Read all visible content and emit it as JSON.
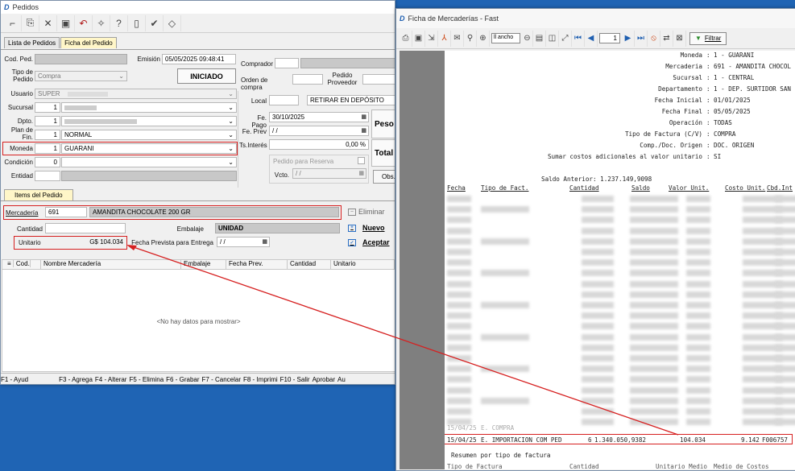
{
  "pedidos": {
    "title": "Pedidos",
    "tabs": [
      "Lista de Pedidos",
      "Ficha del Pedido"
    ],
    "labels": {
      "cod_ped": "Cod. Ped.",
      "emision": "Emisión",
      "tipo_pedido": "Tipo de Pedido",
      "usuario": "Usuario",
      "sucursal": "Sucursal",
      "dpto": "Dpto.",
      "plan_fin": "Plan de Fin.",
      "moneda": "Moneda",
      "condicion": "Condición",
      "entidad": "Entidad",
      "comprador": "Comprador",
      "orden_compra": "Orden de compra",
      "pedido_proveedor": "Pedido Proveedor",
      "local": "Local",
      "fe_pago": "Fe. Pago",
      "fe_prev": "Fe. Prev",
      "tasa_interes": "Ts.Interés",
      "pedido_reserva": "Pedido para Reserva",
      "vcto": "Vcto.",
      "peso": "Peso",
      "total": "Total",
      "obs": "Obs."
    },
    "values": {
      "emision": "05/05/2025 09:48:41",
      "tipo_pedido": "Compra",
      "estado": "INICIADO",
      "usuario": "SUPER",
      "sucursal": "1",
      "dpto": "1",
      "plan_fin_code": "1",
      "plan_fin_name": "NORMAL",
      "moneda_code": "1",
      "moneda_name": "GUARANI",
      "condicion": "0",
      "local_value": "RETIRAR EN DEPÓSITO",
      "fe_pago": "30/10/2025",
      "fe_prev": "/ /",
      "tasa_interes": "0,00 %",
      "vcto": "/ /"
    },
    "items": {
      "tab": "Items del Pedido",
      "mercaderia_label": "Mercadería",
      "mercaderia_code": "691",
      "mercaderia_name": "AMANDITA CHOCOLATE 200 GR",
      "eliminar": "Eliminar",
      "cantidad_label": "Cantidad",
      "embalaje_label": "Embalaje",
      "embalaje_value": "UNIDAD",
      "nuevo": "Nuevo",
      "unitario_label": "Unitario",
      "unitario_value": "G$ 104.034",
      "fecha_prevista_label": "Fecha Prevista para Entrega",
      "fecha_prevista_value": "/ /",
      "aceptar": "Aceptar"
    },
    "grid": {
      "columns": [
        "Cod.",
        "Nombre Mercadería",
        "Embalaje",
        "Fecha Prev.",
        "Cantidad",
        "Unitario"
      ],
      "empty": "<No hay datos para mostrar>"
    },
    "status": [
      "F1 - Ayud",
      "F3 - Agrega",
      "F4 - Alterar",
      "F5 - Elimina",
      "F6 - Grabar",
      "F7 - Cancelar",
      "F8 - Imprimi",
      "F10 - Salir",
      "Aprobar",
      "Au"
    ]
  },
  "fast": {
    "title": "Ficha de Mercaderías - Fast",
    "zoom": "ll ancho",
    "page": "1",
    "filter": "Filtrar",
    "header": [
      {
        "k": "Moneda",
        "v": "1 - GUARANI"
      },
      {
        "k": "Mercaderia",
        "v": "691 - AMANDITA CHOCOL"
      },
      {
        "k": "Sucursal",
        "v": "1 - CENTRAL"
      },
      {
        "k": "Departamento",
        "v": "1 - DEP. SURTIDOR SAN"
      },
      {
        "k": "Fecha Inicial",
        "v": "01/01/2025"
      },
      {
        "k": "Fecha Final",
        "v": "05/05/2025"
      },
      {
        "k": "Operación",
        "v": "TODAS"
      },
      {
        "k": "Tipo de Factura (C/V)",
        "v": "COMPRA"
      },
      {
        "k": "Comp./Doc. Origen",
        "v": "DOC. ORIGEN"
      },
      {
        "k": "Sumar costos adicionales al valor unitario",
        "v": "SI"
      }
    ],
    "saldo_anterior": "Saldo Anterior: 1.237.149,9098",
    "columns": [
      "Fecha",
      "Tipo de Fact.",
      "Cantidad",
      "Saldo",
      "Valor Unit.",
      "Costo Unit.",
      "Cbd.Int"
    ],
    "highlight_row": {
      "fecha": "15/04/25",
      "tipo": "E. IMPORTACION COM PED",
      "cantidad": "6",
      "saldo": "1.340.050,9382",
      "valor": "104.034",
      "costo": "9.142",
      "cbd": "F006757"
    },
    "partial_row": {
      "fecha": "15/04/25",
      "tipo": "E. COMPRA"
    },
    "resumen": "Resumen por tipo de factura",
    "resumen_cols": [
      "Tipo de Factura",
      "Cantidad",
      "Unitario Medio",
      "Medio de Costos"
    ]
  }
}
